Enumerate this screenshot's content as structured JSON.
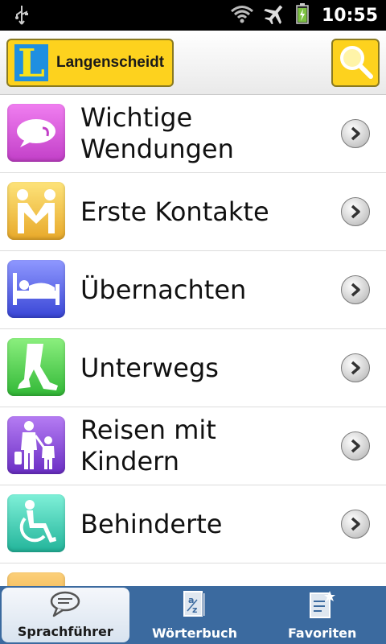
{
  "statusbar": {
    "time": "10:55"
  },
  "header": {
    "logo_text": "Langenscheidt",
    "logo_letter": "L"
  },
  "list": [
    {
      "label": "Wichtige\nWendungen",
      "icon": "speech-bubble-icon"
    },
    {
      "label": "Erste Kontakte",
      "icon": "handshake-icon"
    },
    {
      "label": "Übernachten",
      "icon": "bed-icon"
    },
    {
      "label": "Unterwegs",
      "icon": "walking-legs-icon"
    },
    {
      "label": "Reisen mit\nKindern",
      "icon": "parent-child-icon"
    },
    {
      "label": "Behinderte",
      "icon": "wheelchair-icon"
    },
    {
      "label": "",
      "icon": "partial-icon"
    }
  ],
  "tabs": [
    {
      "label": "Sprachführer",
      "icon": "speech-bubble-icon",
      "active": true
    },
    {
      "label": "Wörterbuch",
      "icon": "dictionary-icon",
      "active": false
    },
    {
      "label": "Favoriten",
      "icon": "favorites-list-icon",
      "active": false
    }
  ],
  "colors": {
    "brand_yellow": "#fdd21e",
    "tab_bar": "#3b6a9f",
    "logo_blue": "#1f8fe0"
  }
}
